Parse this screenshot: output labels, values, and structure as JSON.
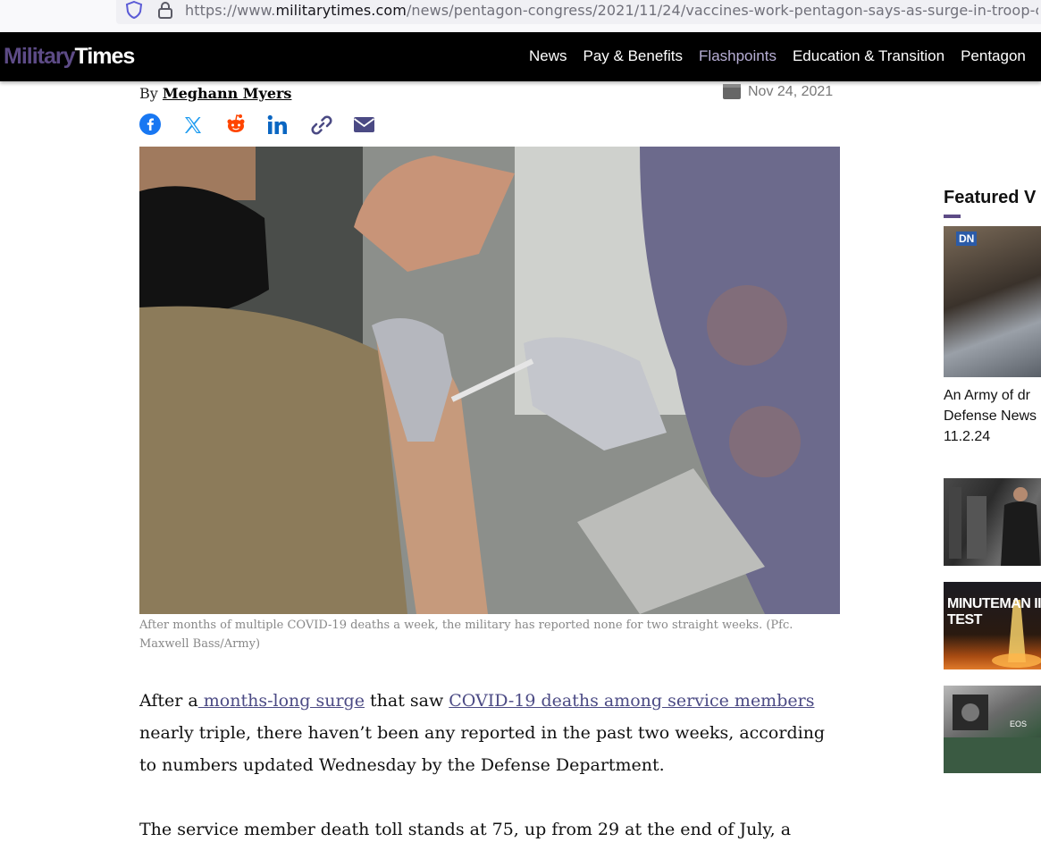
{
  "browser": {
    "url_prefix": "https://www.",
    "url_host": "militarytimes.com",
    "url_path": "/news/pentagon-congress/2021/11/24/vaccines-work-pentagon-says-as-surge-in-troop-covid-"
  },
  "site": {
    "logo_part1": "Military",
    "logo_part2": "Times",
    "nav": [
      "News",
      "Pay & Benefits",
      "Flashpoints",
      "Education & Transition",
      "Pentagon"
    ],
    "active_nav": "Flashpoints",
    "brand_color": "#5d4b86"
  },
  "article": {
    "by_label": "By",
    "author": "Meghann Myers",
    "date": "Nov 24, 2021",
    "share_icons": [
      "facebook-icon",
      "x-icon",
      "reddit-icon",
      "linkedin-icon",
      "link-icon",
      "email-icon"
    ],
    "caption": "After months of multiple COVID-19 deaths a week, the military has reported none for two straight weeks. (Pfc. Maxwell Bass/Army)",
    "p1_a": "After a",
    "p1_link1": " months-long surge",
    "p1_b": " that saw ",
    "p1_link2": "COVID-19 deaths among service members",
    "p1_c": " nearly triple, there haven’t been any reported in the past two weeks, according to numbers updated Wednesday by the Defense Department.",
    "p2": "The service member death toll stands at 75, up from 29 at the end of July, a number that"
  },
  "sidebar": {
    "heading": "Featured V",
    "video1_title": "An Army of dr\nDefense News\n11.2.24",
    "video1_badge": "DN",
    "video3_overlay": "MINUTEMAN III\nTEST",
    "video4_overlay": "EOS"
  }
}
